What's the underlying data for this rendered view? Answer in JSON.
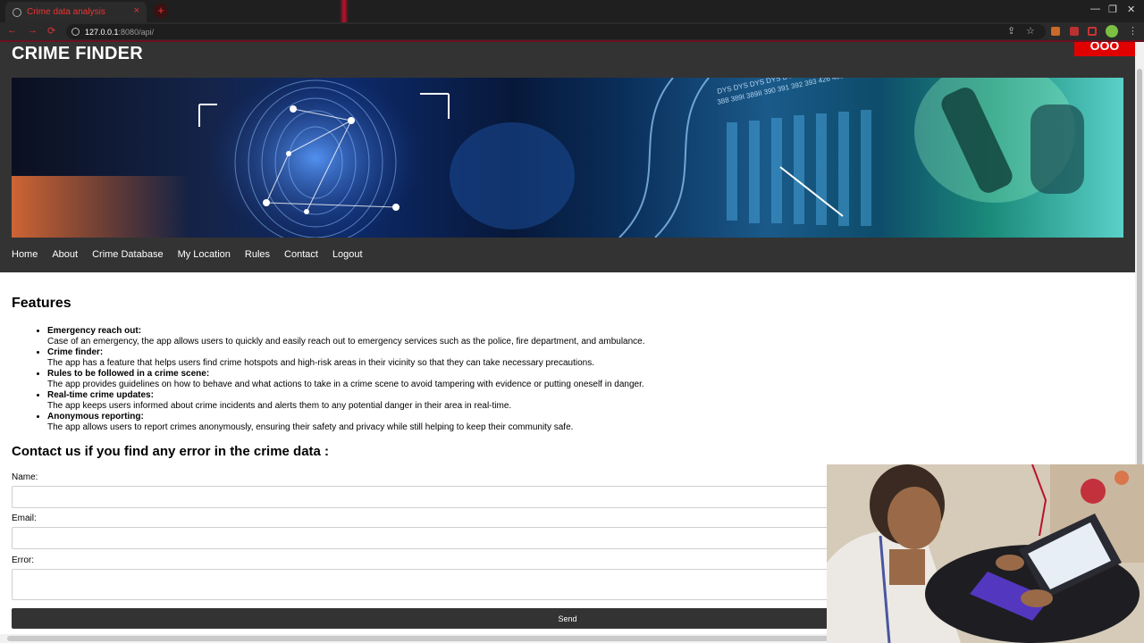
{
  "browser": {
    "tab_title": "Crime data analysis",
    "tab_close": "×",
    "new_tab": "+",
    "url_host": "127.0.0.1",
    "url_path": ":8080/api/",
    "back": "←",
    "forward": "→",
    "reload": "⟳",
    "share": "⇪",
    "star": "☆",
    "minimize": "—",
    "maximize": "❐",
    "close": "✕",
    "menu": "⋮"
  },
  "site": {
    "title": "CRIME FINDER",
    "badge": "OOO"
  },
  "nav": {
    "items": [
      "Home",
      "About",
      "Crime Database",
      "My Location",
      "Rules",
      "Contact",
      "Logout"
    ]
  },
  "features": {
    "title": "Features",
    "items": [
      {
        "title": "Emergency reach out:",
        "desc": "Case of an emergency, the app allows users to quickly and easily reach out to emergency services such as the police, fire department, and ambulance."
      },
      {
        "title": "Crime finder:",
        "desc": "The app has a feature that helps users find crime hotspots and high-risk areas in their vicinity so that they can take necessary precautions."
      },
      {
        "title": "Rules to be followed in a crime scene:",
        "desc": "The app provides guidelines on how to behave and what actions to take in a crime scene to avoid tampering with evidence or putting oneself in danger."
      },
      {
        "title": "Real-time crime updates:",
        "desc": "The app keeps users informed about crime incidents and alerts them to any potential danger in their area in real-time."
      },
      {
        "title": "Anonymous reporting:",
        "desc": "The app allows users to report crimes anonymously, ensuring their safety and privacy while still helping to keep their community safe."
      }
    ]
  },
  "contact": {
    "title": "Contact us if you find any error in the crime data :",
    "name_label": "Name:",
    "email_label": "Email:",
    "error_label": "Error:",
    "name_value": "",
    "email_value": "",
    "error_value": "",
    "send_label": "Send"
  },
  "colors": {
    "header_bg": "#333333",
    "accent_red": "#e00000"
  }
}
